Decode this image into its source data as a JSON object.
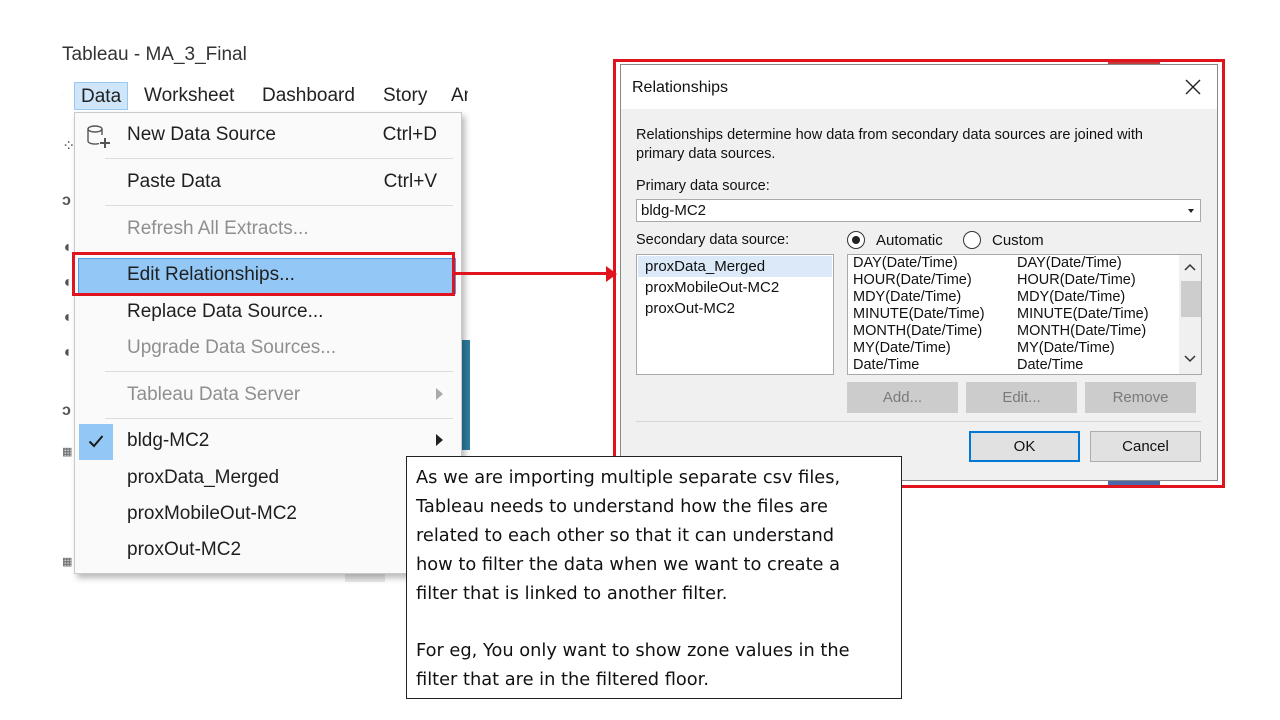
{
  "app": {
    "window_title": "Tableau - MA_3_Final",
    "menubar": [
      "Data",
      "Worksheet",
      "Dashboard",
      "Story",
      "An"
    ]
  },
  "data_menu": {
    "items": [
      {
        "label": "New Data Source",
        "shortcut": "Ctrl+D",
        "enabled": true,
        "icon": "data-source-icon"
      },
      {
        "label": "Paste Data",
        "shortcut": "Ctrl+V",
        "enabled": true
      },
      {
        "label": "Refresh All Extracts...",
        "enabled": false
      },
      {
        "label": "Edit Relationships...",
        "enabled": true,
        "highlighted": true
      },
      {
        "label": "Replace Data Source...",
        "enabled": true
      },
      {
        "label": "Upgrade Data Sources...",
        "enabled": false
      },
      {
        "label": "Tableau Data Server",
        "enabled": false,
        "submenu": true
      },
      {
        "label": "bldg-MC2",
        "enabled": true,
        "checked": true,
        "submenu": true
      },
      {
        "label": "proxData_Merged",
        "enabled": true
      },
      {
        "label": "proxMobileOut-MC2",
        "enabled": true
      },
      {
        "label": "proxOut-MC2",
        "enabled": true
      }
    ]
  },
  "dialog": {
    "title": "Relationships",
    "description_line1": "Relationships determine how data from secondary data sources are joined with",
    "description_line2": "primary data sources.",
    "primary_label": "Primary data source:",
    "primary_value": "bldg-MC2",
    "secondary_label": "Secondary data source:",
    "radio_automatic": "Automatic",
    "radio_custom": "Custom",
    "selected_mode": "Automatic",
    "secondary_sources": [
      "proxData_Merged",
      "proxMobileOut-MC2",
      "proxOut-MC2"
    ],
    "selected_secondary": "proxData_Merged",
    "mappings": [
      [
        "DAY(Date/Time)",
        "DAY(Date/Time)"
      ],
      [
        "HOUR(Date/Time)",
        "HOUR(Date/Time)"
      ],
      [
        "MDY(Date/Time)",
        "MDY(Date/Time)"
      ],
      [
        "MINUTE(Date/Time)",
        "MINUTE(Date/Time)"
      ],
      [
        "MONTH(Date/Time)",
        "MONTH(Date/Time)"
      ],
      [
        "MY(Date/Time)",
        "MY(Date/Time)"
      ],
      [
        "Date/Time",
        "Date/Time"
      ]
    ],
    "buttons": {
      "add": "Add...",
      "edit": "Edit...",
      "remove": "Remove",
      "ok": "OK",
      "cancel": "Cancel"
    }
  },
  "annotation": {
    "para1_lines": [
      "As we are importing multiple separate csv files,",
      "Tableau needs to understand how the files are",
      "related to each other so that it can understand",
      "how to filter the data when we want to create a",
      "filter that is linked to another filter."
    ],
    "para2_lines": [
      "For eg, You only want to show zone values in the",
      "filter that are in the filtered floor."
    ]
  },
  "colors": {
    "highlight_red": "#e0141e",
    "menu_highlight": "#93c8f6",
    "default_button_border": "#0078d7"
  }
}
